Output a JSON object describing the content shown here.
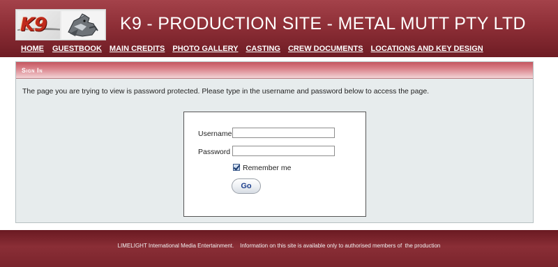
{
  "header": {
    "site_title": "K9 - PRODUCTION SITE - METAL MUTT PTY LTD",
    "logo_text": "K9"
  },
  "nav": {
    "items": [
      {
        "label": "HOME"
      },
      {
        "label": "GUESTBOOK"
      },
      {
        "label": "MAIN CREDITS"
      },
      {
        "label": "PHOTO GALLERY"
      },
      {
        "label": "CASTING"
      },
      {
        "label": "CREW DOCUMENTS"
      },
      {
        "label": "LOCATIONS AND KEY DESIGN"
      }
    ]
  },
  "panel": {
    "heading": "Sign In",
    "message": "The page you are trying to view is password protected. Please type in the username and password below to access the page."
  },
  "login": {
    "username_label": "Username",
    "username_value": "",
    "password_label": "Password",
    "password_value": "",
    "remember_label": "Remember me",
    "remember_checked": true,
    "go_label": "Go"
  },
  "footer": {
    "text": "LIMELIGHT International Media Entertainment.    Information on this site is available only to authorised members of  the production"
  },
  "colors": {
    "header_red": "#8e2f37",
    "panel_bg": "#e7eced",
    "go_text": "#1e3f8c"
  }
}
